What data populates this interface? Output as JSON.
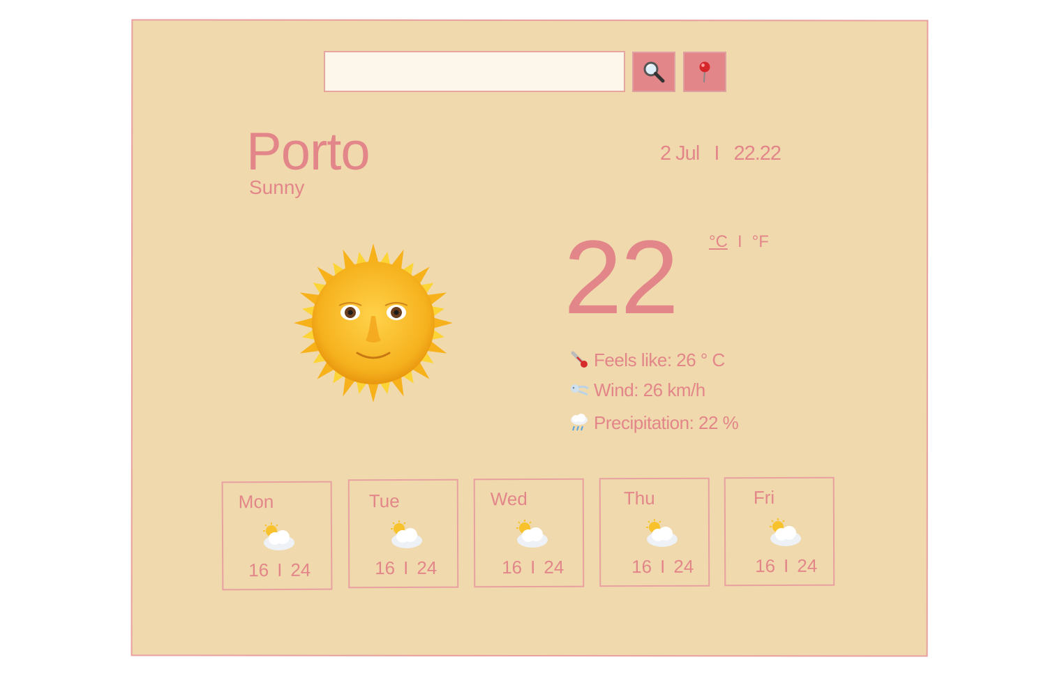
{
  "search": {
    "placeholder": "",
    "value": ""
  },
  "buttons": {
    "search_icon": "magnifying-glass",
    "location_icon": "round-pushpin"
  },
  "current": {
    "city": "Porto",
    "condition": "Sunny",
    "date": "2 Jul",
    "date_sep": "I",
    "time": "22.22",
    "temperature": "22",
    "unit_celsius": "°C",
    "unit_sep": "I",
    "unit_fahrenheit": "°F",
    "icon": "sun-with-face",
    "feels_like": "Feels like: 26 ° C",
    "wind": "Wind: 26 km/h",
    "precipitation": "Precipitation: 22 %"
  },
  "forecast": [
    {
      "day": "Mon",
      "min": "16",
      "sep": "I",
      "max": "24",
      "icon": "sun-behind-cloud"
    },
    {
      "day": "Tue",
      "min": "16",
      "sep": "I",
      "max": "24",
      "icon": "sun-behind-cloud"
    },
    {
      "day": "Wed",
      "min": "16",
      "sep": "I",
      "max": "24",
      "icon": "sun-behind-cloud"
    },
    {
      "day": "Thu",
      "min": "16",
      "sep": "I",
      "max": "24",
      "icon": "sun-behind-cloud"
    },
    {
      "day": "Fri",
      "min": "16",
      "sep": "I",
      "max": "24",
      "icon": "sun-behind-cloud"
    }
  ],
  "colors": {
    "background": "#f0d9ad",
    "accent": "#e3868a",
    "border": "#e8a0a0",
    "input_bg": "#fdf6eb"
  }
}
